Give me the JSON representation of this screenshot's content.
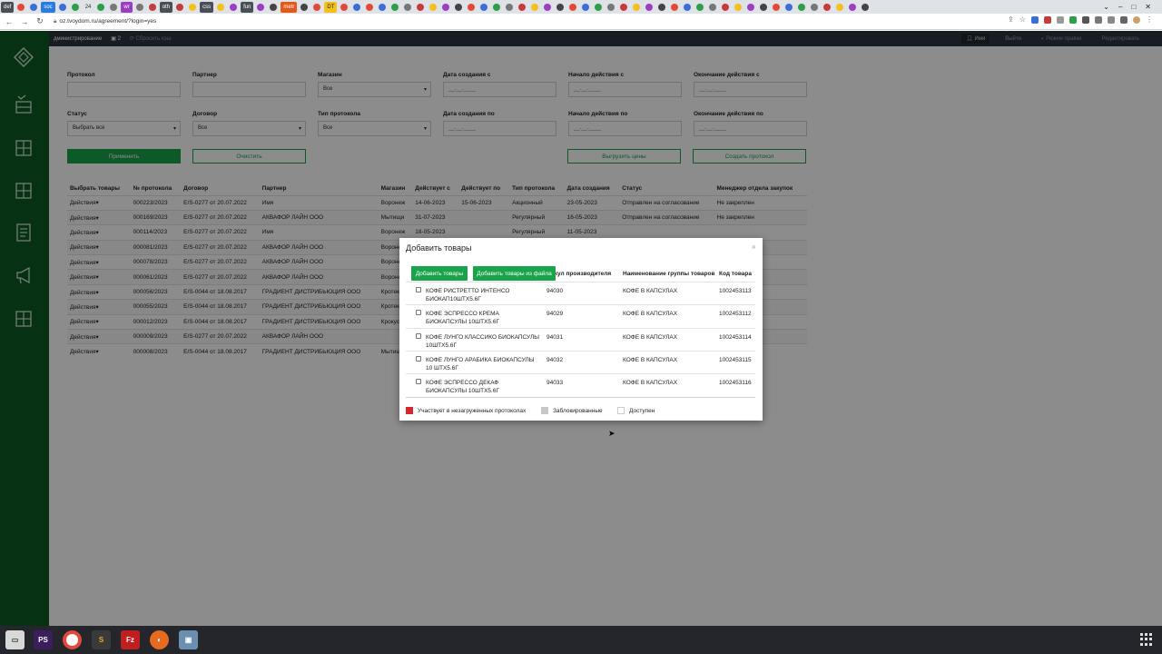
{
  "browser": {
    "tabs": [
      {
        "label": "def",
        "style": "pill"
      },
      {
        "label": "soc",
        "style": "blue"
      },
      {
        "label": "24",
        "style": ""
      },
      {
        "label": "wr",
        "style": "purple"
      },
      {
        "label": "oth",
        "style": "pill"
      },
      {
        "label": "css",
        "style": "pill"
      },
      {
        "label": "fun",
        "style": "pill"
      },
      {
        "label": "metr",
        "style": "orange"
      },
      {
        "label": "DT",
        "style": "yellow"
      }
    ],
    "url": "oz.tvoydom.ru/agreement/?login=yes"
  },
  "topbar": {
    "section": "дминистрирование",
    "badge_count": "2",
    "refresh_label": "Сбросить кэш",
    "user": "Имя",
    "logout": "Выйти",
    "mode_label": "Режим правки",
    "edit_label": "Редактировать"
  },
  "filters": {
    "protocol_label": "Протокол",
    "partner_label": "Партнер",
    "store_label": "Магазин",
    "store_value": "Все",
    "created_from_label": "Дата создания с",
    "start_from_label": "Начало действия с",
    "end_from_label": "Окончание действия с",
    "status_label": "Статус",
    "status_value": "Выбрать все",
    "contract_label": "Договор",
    "contract_value": "Все",
    "type_label": "Тип протокола",
    "type_value": "Все",
    "created_to_label": "Дата создания по",
    "start_to_label": "Начало действия по",
    "end_to_label": "Окончание действия по",
    "date_placeholder": "__.__.____",
    "apply_label": "Применить",
    "clear_label": "Очистить",
    "export_label": "Выгрузить цены",
    "create_label": "Создать протокол"
  },
  "table": {
    "headers": [
      "Выбрать товары",
      "№ протокола",
      "Договор",
      "Партнер",
      "Магазин",
      "Действует с",
      "Действует по",
      "Тип протокола",
      "Дата создания",
      "Статус",
      "Менеджер отдела закупок"
    ],
    "rows": [
      [
        "Действия",
        "000223/2023",
        "E/S-0277 от 20.07.2022",
        "Имя",
        "Воронеж",
        "14-06-2023",
        "15-06-2023",
        "Акционный",
        "23-05-2023",
        "Отправлен на согласование",
        "Не закреплен"
      ],
      [
        "Действия",
        "000169/2023",
        "E/S-0277 от 20.07.2022",
        "АКВАФОР ЛАЙН ООО",
        "Мытищи",
        "31-07-2023",
        "",
        "Регулярный",
        "16-05-2023",
        "Отправлен на согласование",
        "Не закреплен"
      ],
      [
        "Действия",
        "000114/2023",
        "E/S-0277 от 20.07.2022",
        "Имя",
        "Воронеж",
        "18-05-2023",
        "",
        "Регулярный",
        "11-05-2023",
        "",
        ""
      ],
      [
        "Действия",
        "000081/2023",
        "E/S-0277 от 20.07.2022",
        "АКВАФОР ЛАЙН ООО",
        "Воронеж",
        "",
        "",
        "",
        "",
        "",
        ""
      ],
      [
        "Действия",
        "000078/2023",
        "E/S-0277 от 20.07.2022",
        "АКВАФОР ЛАЙН ООО",
        "Воронеж",
        "",
        "",
        "",
        "",
        "",
        ""
      ],
      [
        "Действия",
        "000061/2023",
        "E/S-0277 от 20.07.2022",
        "АКВАФОР ЛАЙН ООО",
        "Воронеж",
        "",
        "",
        "",
        "",
        "",
        ""
      ],
      [
        "Действия",
        "000056/2023",
        "E/S-0044 от 18.08.2017",
        "ГРАДИЕНТ ДИСТРИБЬЮЦИЯ ООО",
        "Кротекс",
        "",
        "",
        "",
        "",
        "",
        ""
      ],
      [
        "Действия",
        "000055/2023",
        "E/S-0044 от 18.08.2017",
        "ГРАДИЕНТ ДИСТРИБЬЮЦИЯ ООО",
        "Кротекс",
        "",
        "",
        "",
        "",
        "",
        ""
      ],
      [
        "Действия",
        "000012/2023",
        "E/S-0044 от 18.08.2017",
        "ГРАДИЕНТ ДИСТРИБЬЮЦИЯ ООО",
        "Крокус С",
        "",
        "",
        "",
        "",
        "",
        ""
      ],
      [
        "Действия",
        "000009/2023",
        "E/S-0277 от 20.07.2022",
        "АКВАФОР ЛАЙН ООО",
        "",
        "",
        "",
        "",
        "",
        "",
        ""
      ],
      [
        "Действия",
        "000008/2023",
        "E/S-0044 от 18.08.2017",
        "ГРАДИЕНТ ДИСТРИБЬЮЦИЯ ООО",
        "Мытищи",
        "",
        "",
        "",
        "",
        "",
        ""
      ]
    ]
  },
  "modal": {
    "title": "Добавить товары",
    "close": "×",
    "add_button": "Добавить товары",
    "add_file_button": "Добавить товары из файла",
    "col_article": "Артикул производителя",
    "col_group": "Наименование группы товаров",
    "col_code": "Код товара",
    "items": [
      {
        "name": "КОФЕ РИСТРЕТТО ИНТЕНСО БИОКАП10ШТХ5.6Г",
        "article": "94030",
        "group": "КОФЕ В КАПСУЛАХ",
        "code": "1002453113"
      },
      {
        "name": "КОФЕ ЭСПРЕССО КРЕМА БИОКАПСУЛЫ 10ШТХ5.6Г",
        "article": "94029",
        "group": "КОФЕ В КАПСУЛАХ",
        "code": "1002453112"
      },
      {
        "name": "КОФЕ ЛУНГО КЛАССИКО БИОКАПСУЛЫ 10ШТХ5.6Г",
        "article": "94031",
        "group": "КОФЕ В КАПСУЛАХ",
        "code": "1002453114"
      },
      {
        "name": "КОФЕ ЛУНГО АРАБИКА БИОКАПСУЛЫ 10 ШТХ5.6Г",
        "article": "94032",
        "group": "КОФЕ В КАПСУЛАХ",
        "code": "1002453115"
      },
      {
        "name": "КОФЕ ЭСПРЕССО ДЕКАФ БИОКАПСУЛЫ 10ШТХ5.6Г",
        "article": "94033",
        "group": "КОФЕ В КАПСУЛАХ",
        "code": "1002453116"
      }
    ],
    "legend": {
      "unloaded": "Участвует в незагруженных протоколах",
      "blocked": "Заблокированные",
      "available": "Доступен"
    }
  },
  "colors": {
    "brand_green": "#19a34a",
    "sidebar_green": "#0e5a23",
    "legend_red": "#d9262c",
    "legend_gray": "#c8c8c8"
  }
}
